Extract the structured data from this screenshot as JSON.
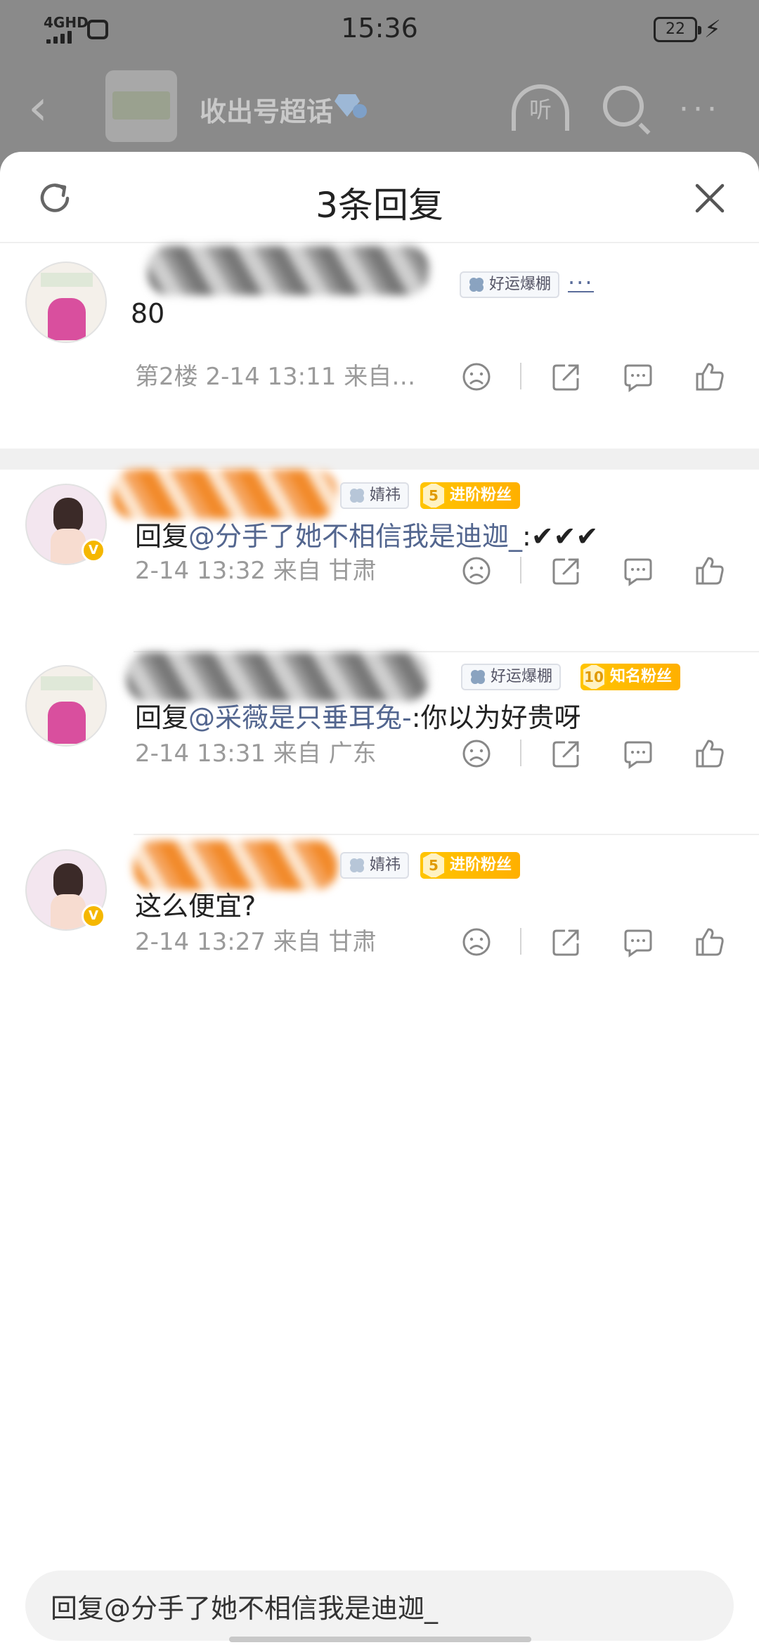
{
  "status_bar": {
    "network": "4GHD",
    "time": "15:36",
    "battery": "22"
  },
  "topbar": {
    "title": "收出号超话",
    "listen_label": "听",
    "more": "···"
  },
  "sheet": {
    "title": "3条回复"
  },
  "comments": [
    {
      "tag_label": "好运爆棚",
      "more": "···",
      "text": "80",
      "meta": "第2楼  2-14 13:11  来自…"
    },
    {
      "tag_label": "婧祎",
      "fan_level": "5",
      "fan_label": "进阶粉丝",
      "text_prefix": "回复",
      "mention": "@分手了她不相信我是迪迦_",
      "text_suffix": ":✔✔✔",
      "meta": "2-14 13:32  来自 甘肃"
    },
    {
      "tag_label": "好运爆棚",
      "fan_level": "10",
      "fan_label": "知名粉丝",
      "text_prefix": "回复",
      "mention": "@采薇是只垂耳兔-",
      "text_suffix": ":你以为好贵呀",
      "meta": "2-14 13:31  来自 广东"
    },
    {
      "tag_label": "婧祎",
      "fan_level": "5",
      "fan_label": "进阶粉丝",
      "text": "这么便宜?",
      "meta": "2-14 13:27  来自 甘肃"
    }
  ],
  "reply_input": {
    "value": "回复@分手了她不相信我是迪迦_"
  },
  "colors": {
    "mention": "#53668f",
    "fan_badge": "#ffc400",
    "verified_badge": "#f5b700",
    "meta_text": "#9a9a9a"
  },
  "icons": [
    "refresh-icon",
    "close-icon",
    "dislike-face-icon",
    "share-icon",
    "comment-icon",
    "thumbs-up-icon",
    "clover-icon",
    "verified-icon"
  ]
}
